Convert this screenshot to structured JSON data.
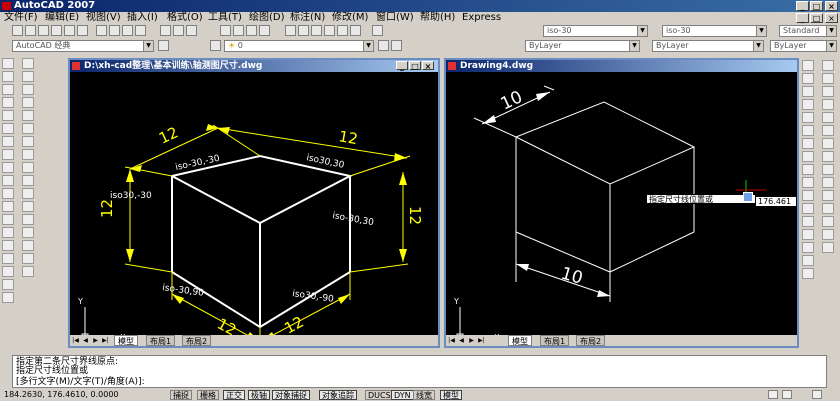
{
  "app": {
    "title": "AutoCAD 2007"
  },
  "menu": [
    "文件(F)",
    "编辑(E)",
    "视图(V)",
    "插入(I)",
    "格式(O)",
    "工具(T)",
    "绘图(D)",
    "标注(N)",
    "修改(M)",
    "窗口(W)",
    "帮助(H)",
    "Express"
  ],
  "toolbar": {
    "workspace": "AutoCAD 经典",
    "layer_combo": "0",
    "dimstyle_combo": "iso-30",
    "textstyle_combo": "iso-30",
    "tablestyle_combo": "Standard",
    "color_combo": "ByLayer",
    "linetype_combo": "ByLayer",
    "lineweight_combo": "ByLayer"
  },
  "window_left": {
    "title": "D:\\xh-cad整理\\基本训练\\轴测图尺寸.dwg",
    "tabs": [
      "模型",
      "布局1",
      "布局2"
    ],
    "active_tab": "模型",
    "dims": {
      "top_left": "12",
      "top_right": "12",
      "left_side": "12",
      "right_side": "12",
      "bottom_left": "12",
      "bottom_right": "12",
      "lbl_top_left": "iso-30,-30",
      "lbl_top_right": "iso30,30",
      "lbl_left": "iso30,-30",
      "lbl_right": "iso-30,30",
      "lbl_bottom_left": "iso-30,90",
      "lbl_bottom_right": "iso30,-90"
    },
    "ucs": {
      "x": "X",
      "y": "Y"
    }
  },
  "window_right": {
    "title": "Drawing4.dwg",
    "tabs": [
      "模型",
      "布局1",
      "布局2"
    ],
    "active_tab": "模型",
    "dims": {
      "top": "10",
      "bottom": "10"
    },
    "tooltip": "指定尺寸线位置或",
    "coord_value": "176.461",
    "ucs": {
      "x": "X",
      "y": "Y"
    }
  },
  "command": {
    "line1": "指定第二条尺寸界线原点:",
    "line2": "指定尺寸线位置或",
    "line3": "[多行文字(M)/文字(T)/角度(A)]:"
  },
  "status": {
    "coords": "184.2630, 176.4610, 0.0000",
    "toggles": [
      "捕捉",
      "栅格",
      "正交",
      "极轴",
      "对象捕捉",
      "对象追踪",
      "DUCS",
      "DYN",
      "线宽",
      "模型"
    ]
  },
  "colors": {
    "dimension": "#ffff00",
    "geometry": "#ffffff",
    "canvas": "#000000",
    "titlebar": "#0a246a"
  }
}
